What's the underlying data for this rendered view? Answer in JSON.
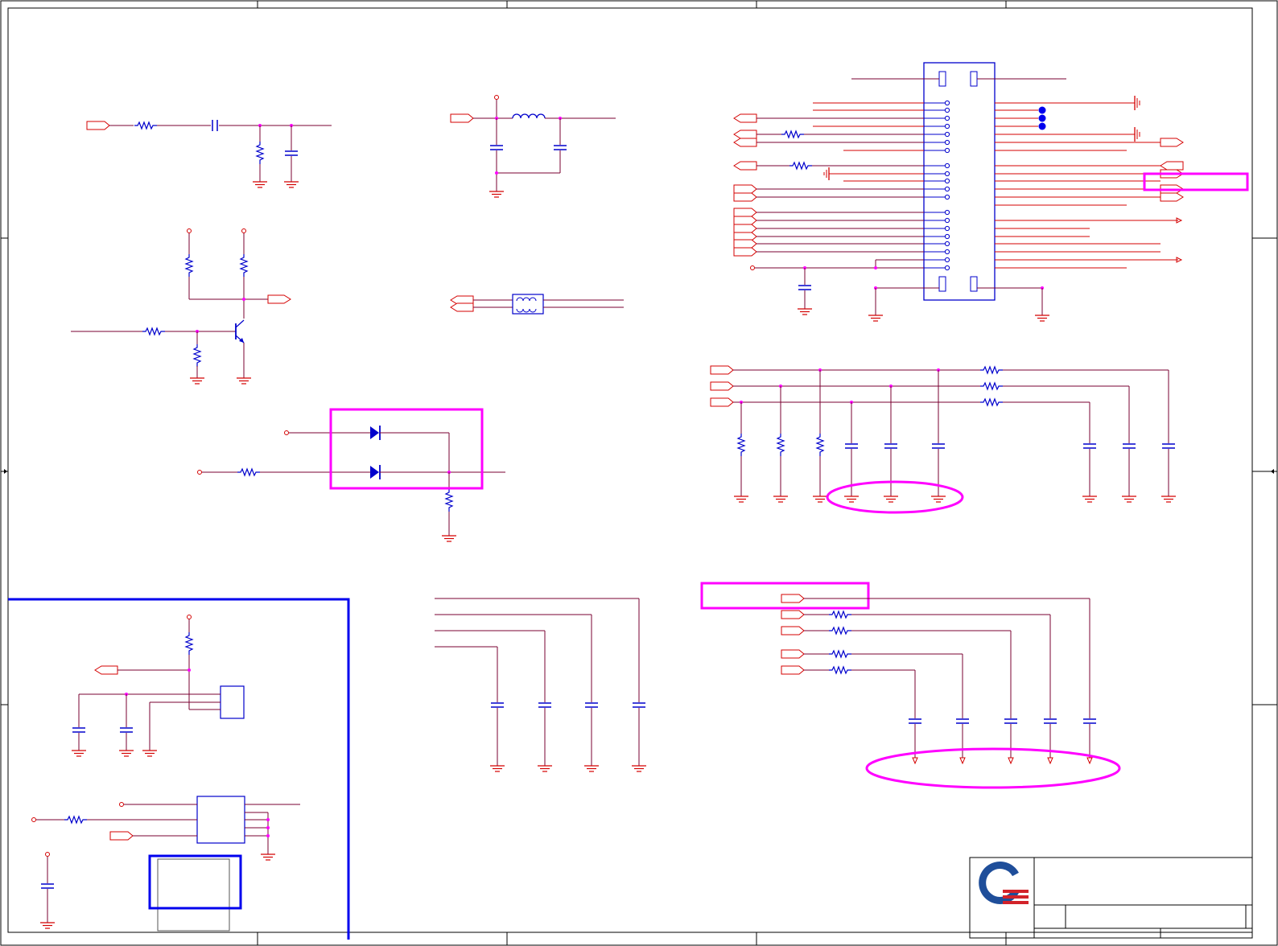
{
  "diagram": {
    "type": "electrical-schematic",
    "title_block": {
      "logo": "company-logo",
      "colors": {
        "logo_blue": "#1f4e9a",
        "logo_red": "#d2232a"
      }
    },
    "colors": {
      "wire": "#7a0030",
      "net_red": "#d40000",
      "component_blue": "#0000cc",
      "highlight": "#ff00ff",
      "border": "#000000",
      "frame_blue": "#0000ee"
    }
  }
}
